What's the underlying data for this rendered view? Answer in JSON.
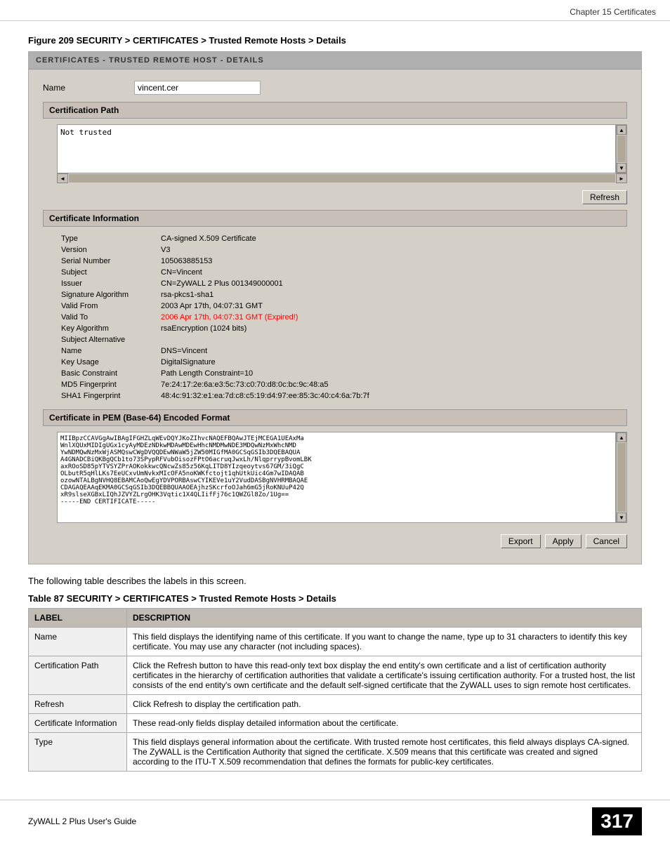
{
  "header": {
    "title": "Chapter 15 Certificates"
  },
  "figure": {
    "caption": "Figure 209   SECURITY > CERTIFICATES > Trusted Remote Hosts > Details",
    "screen_title": "CERTIFICATES - TRUSTED REMOTE HOST - DETAILS",
    "name_label": "Name",
    "name_value": "vincent.cer",
    "cert_path_section": "Certification Path",
    "cert_path_text": "Not trusted",
    "refresh_btn": "Refresh",
    "cert_info_section": "Certificate Information",
    "cert_info_rows": [
      {
        "label": "Type",
        "value": "CA-signed X.509 Certificate",
        "expired": false
      },
      {
        "label": "Version",
        "value": "V3",
        "expired": false
      },
      {
        "label": "Serial Number",
        "value": "105063885153",
        "expired": false
      },
      {
        "label": "Subject",
        "value": "CN=Vincent",
        "expired": false
      },
      {
        "label": "Issuer",
        "value": "CN=ZyWALL 2 Plus 001349000001",
        "expired": false
      },
      {
        "label": "Signature Algorithm",
        "value": "rsa-pkcs1-sha1",
        "expired": false
      },
      {
        "label": "Valid From",
        "value": "2003 Apr 17th, 04:07:31 GMT",
        "expired": false
      },
      {
        "label": "Valid To",
        "value": "2006 Apr 17th, 04:07:31 GMT (Expired!)",
        "expired": true
      },
      {
        "label": "Key Algorithm",
        "value": "rsaEncryption (1024 bits)",
        "expired": false
      },
      {
        "label": "Subject Alternative",
        "value": "",
        "expired": false
      },
      {
        "label": "Name",
        "value": "DNS=Vincent",
        "expired": false
      },
      {
        "label": "Key Usage",
        "value": "DigitalSignature",
        "expired": false
      },
      {
        "label": "Basic Constraint",
        "value": "Path Length Constraint=10",
        "expired": false
      },
      {
        "label": "MD5 Fingerprint",
        "value": "7e:24:17:2e:6a:e3:5c:73:c0:70:d8:0c:bc:9c:48:a5",
        "expired": false
      },
      {
        "label": "SHA1 Fingerprint",
        "value": "48:4c:91:32:e1:ea:7d:c8:c5:19:d4:97:ee:85:3c:40:c4:6a:7b:7f",
        "expired": false
      }
    ],
    "pem_section": "Certificate in PEM (Base-64) Encoded Format",
    "pem_text": "MIIBpzCCAVGgAwIBAgIFGHZLqWEvDQYJKoZIhvcNAQEFBQAwJTEjMCEGA1UEAxMa\nWnlXQUxMIDIgUGx1cyAyMDEzNDkwMDAwMDEwHhcNMDMwNDE3MDQwNzMxWhcNMD\nYwNDMQwNzMxWjASMQswCWgDVQQDEwNWaW5jZW50MIGfMA0GCSqGSIb3DQEBAQUA\nA4GNADCBiQKBgQCb1to73SPypRFVubOisozFPtO6acruqJwxLh/NlqprrypBvomLBK\naxROoSD85pYTVSYZPrAOKokkwcQNcwZs85z56KqLITD8YIzqeoytvs67GM/3iQgC\nOLbutR5qHlLKs7EeUCxvUmNvkxMIcOFA5noKWKfctojt1qhUtkUic4Gm7wIDAQAB\nozowNTALBgNVHQ8EBAMCAoQwEgYDVPORBAswCYIKEVe1uY2VudDASBgNVHRMBAQAE\nCDAGAQEAAqEKMA0GCSqGSIb3DQEBBQUAAOEAjhzSKcrfoOJah6mG5jRoKNUuP42Q\nxR9slseXGBxLIQhJZVYZLrgOHK3Vqtic1X4QLIifFj76c1QWZGl8Zo/1Ug==\n-----END CERTIFICATE-----",
    "export_btn": "Export",
    "apply_btn": "Apply",
    "cancel_btn": "Cancel"
  },
  "following_text": "The following table describes the labels in this screen.",
  "table": {
    "caption": "Table 87   SECURITY > CERTIFICATES > Trusted Remote Hosts > Details",
    "col_label": "LABEL",
    "col_desc": "DESCRIPTION",
    "rows": [
      {
        "label": "Name",
        "description": "This field displays the identifying name of this certificate. If you want to change the name, type up to 31 characters to identify this key certificate. You may use any character (not including spaces)."
      },
      {
        "label": "Certification Path",
        "description": "Click the Refresh button to have this read-only text box display the end entity's own certificate and a list of certification authority certificates in the hierarchy of certification authorities that validate a certificate's issuing certification authority. For a trusted host, the list consists of the end entity's own certificate and the default self-signed certificate that the ZyWALL uses to sign remote host certificates."
      },
      {
        "label": "Refresh",
        "description": "Click Refresh to display the certification path."
      },
      {
        "label": "Certificate Information",
        "description": "These read-only fields display detailed information about the certificate."
      },
      {
        "label": "Type",
        "description": "This field displays general information about the certificate. With trusted remote host certificates, this field always displays CA-signed. The ZyWALL is the Certification Authority that signed the certificate. X.509 means that this certificate was created and signed according to the ITU-T X.509 recommendation that defines the formats for public-key certificates."
      }
    ]
  },
  "footer": {
    "left": "ZyWALL 2 Plus User's Guide",
    "page": "317"
  }
}
